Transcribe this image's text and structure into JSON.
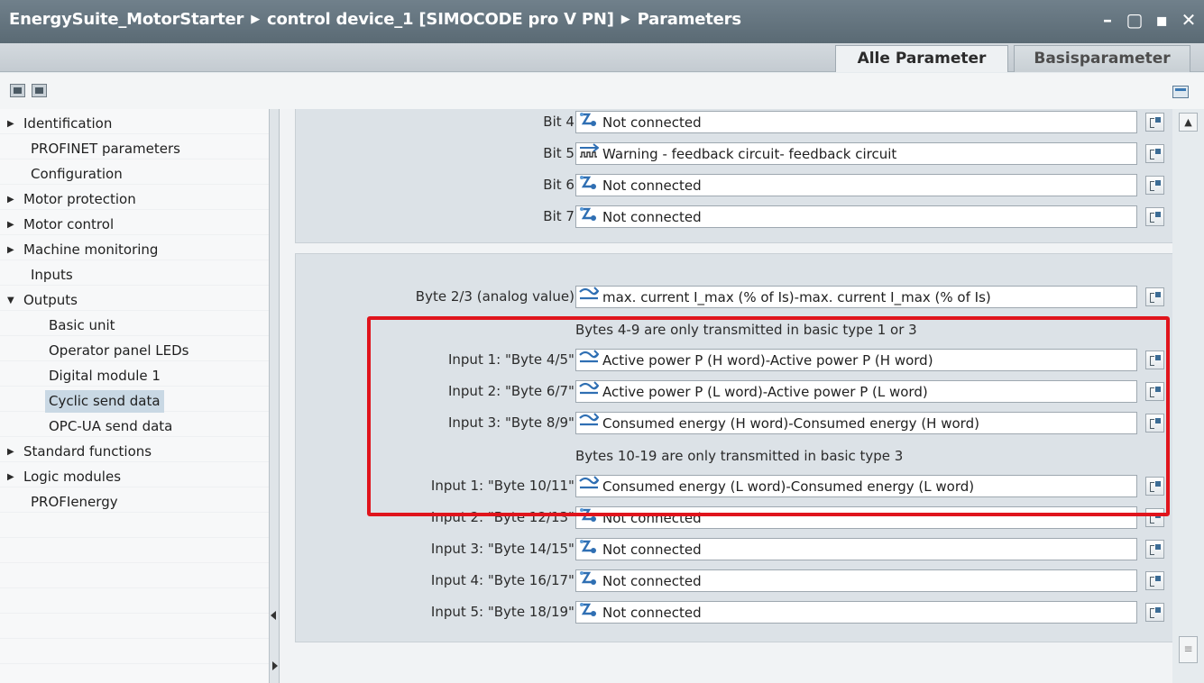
{
  "titlebar": {
    "project": "EnergySuite_MotorStarter",
    "device": "control device_1 [SIMOCODE pro V PN]",
    "page": "Parameters",
    "separator": "▶",
    "controls": [
      "–",
      "▢",
      "▪",
      "✕"
    ]
  },
  "tabs": [
    {
      "label": "Alle Parameter",
      "active": true
    },
    {
      "label": "Basisparameter",
      "active": false
    }
  ],
  "nav": {
    "items": [
      {
        "label": "Identification",
        "expandable": true,
        "expanded": false,
        "level": 0
      },
      {
        "label": "PROFINET parameters",
        "expandable": false,
        "level": 0
      },
      {
        "label": "Configuration",
        "expandable": false,
        "level": 0
      },
      {
        "label": "Motor protection",
        "expandable": true,
        "expanded": false,
        "level": 0
      },
      {
        "label": "Motor control",
        "expandable": true,
        "expanded": false,
        "level": 0
      },
      {
        "label": "Machine monitoring",
        "expandable": true,
        "expanded": false,
        "level": 0
      },
      {
        "label": "Inputs",
        "expandable": false,
        "level": 0
      },
      {
        "label": "Outputs",
        "expandable": true,
        "expanded": true,
        "level": 0
      },
      {
        "label": "Basic unit",
        "level": 1
      },
      {
        "label": "Operator panel LEDs",
        "level": 1
      },
      {
        "label": "Digital module 1",
        "level": 1
      },
      {
        "label": "Cyclic send data",
        "level": 1,
        "selected": true
      },
      {
        "label": "OPC-UA send data",
        "level": 1
      },
      {
        "label": "Standard functions",
        "expandable": true,
        "expanded": false,
        "level": 0
      },
      {
        "label": "Logic modules",
        "expandable": true,
        "expanded": false,
        "level": 0
      },
      {
        "label": "PROFIenergy",
        "expandable": false,
        "level": 0
      }
    ]
  },
  "bits": [
    {
      "label": "Bit 4:",
      "value": "Not connected",
      "icon": "not-connected"
    },
    {
      "label": "Bit 5:",
      "value": "Warning - feedback circuit- feedback circuit",
      "icon": "signal"
    },
    {
      "label": "Bit 6:",
      "value": "Not connected",
      "icon": "not-connected"
    },
    {
      "label": "Bit 7:",
      "value": "Not connected",
      "icon": "not-connected"
    }
  ],
  "analog": {
    "label": "Byte 2/3 (analog value):",
    "value": "max. current I_max (% of Is)-max. current I_max (% of Is)",
    "icon": "analog"
  },
  "note1": "Bytes 4-9 are only transmitted in basic type 1 or 3",
  "group1": [
    {
      "label": "Input 1: \"Byte 4/5\":",
      "value": "Active power P (H word)-Active power P (H word)",
      "icon": "analog"
    },
    {
      "label": "Input 2: \"Byte 6/7\":",
      "value": "Active power P (L word)-Active power P (L word)",
      "icon": "analog"
    },
    {
      "label": "Input 3: \"Byte 8/9\":",
      "value": "Consumed energy (H word)-Consumed energy (H word)",
      "icon": "analog"
    }
  ],
  "note2": "Bytes 10-19 are only transmitted in basic type 3",
  "group2": [
    {
      "label": "Input 1: \"Byte 10/11\":",
      "value": "Consumed energy (L word)-Consumed energy (L word)",
      "icon": "analog"
    },
    {
      "label": "Input 2: \"Byte 12/13\":",
      "value": "Not connected",
      "icon": "not-connected"
    },
    {
      "label": "Input 3: \"Byte 14/15\":",
      "value": "Not connected",
      "icon": "not-connected"
    },
    {
      "label": "Input 4: \"Byte 16/17\":",
      "value": "Not connected",
      "icon": "not-connected"
    },
    {
      "label": "Input 5: \"Byte 18/19\":",
      "value": "Not connected",
      "icon": "not-connected"
    }
  ],
  "colors": {
    "highlight": "#e0141c",
    "title_bg": "#5a6a74",
    "selected_nav": "#c9d8e4"
  }
}
